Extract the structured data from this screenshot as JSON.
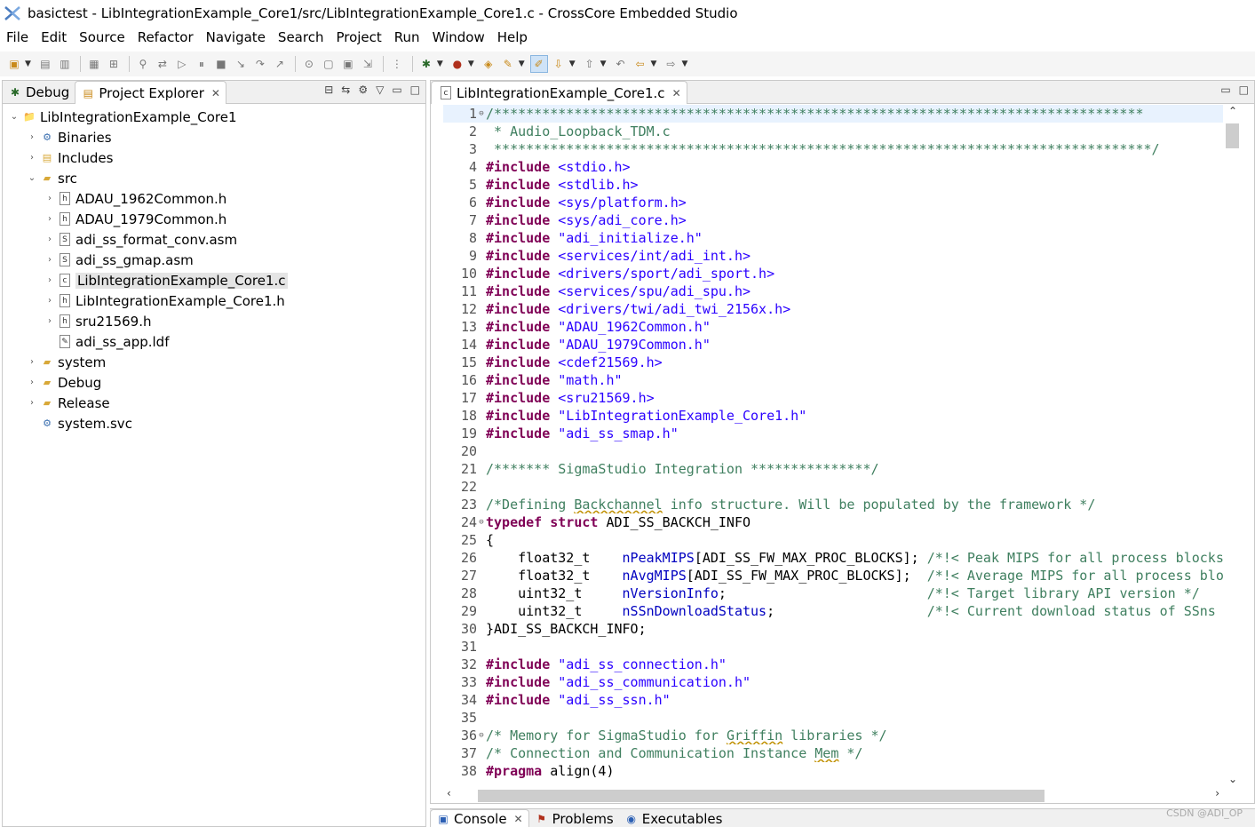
{
  "window": {
    "title": "basictest - LibIntegrationExample_Core1/src/LibIntegrationExample_Core1.c - CrossCore Embedded Studio"
  },
  "menu": [
    "File",
    "Edit",
    "Source",
    "Refactor",
    "Navigate",
    "Search",
    "Project",
    "Run",
    "Window",
    "Help"
  ],
  "left_panel": {
    "tabs": [
      {
        "label": "Debug",
        "icon": "debug-icon"
      },
      {
        "label": "Project Explorer",
        "icon": "project-explorer-icon"
      }
    ],
    "tree": [
      {
        "label": "LibIntegrationExample_Core1",
        "depth": 0,
        "expanded": true,
        "icon": "project-icon"
      },
      {
        "label": "Binaries",
        "depth": 1,
        "expanded": false,
        "icon": "binaries-icon"
      },
      {
        "label": "Includes",
        "depth": 1,
        "expanded": false,
        "icon": "includes-icon"
      },
      {
        "label": "src",
        "depth": 1,
        "expanded": true,
        "icon": "source-folder-icon"
      },
      {
        "label": "ADAU_1962Common.h",
        "depth": 2,
        "expanded": false,
        "icon": "header-file-icon",
        "glyph": "h"
      },
      {
        "label": "ADAU_1979Common.h",
        "depth": 2,
        "expanded": false,
        "icon": "header-file-icon",
        "glyph": "h"
      },
      {
        "label": "adi_ss_format_conv.asm",
        "depth": 2,
        "expanded": false,
        "icon": "asm-file-icon",
        "glyph": "S"
      },
      {
        "label": "adi_ss_gmap.asm",
        "depth": 2,
        "expanded": false,
        "icon": "asm-file-icon",
        "glyph": "S"
      },
      {
        "label": "LibIntegrationExample_Core1.c",
        "depth": 2,
        "expanded": false,
        "icon": "c-file-icon",
        "glyph": "c",
        "selected": true
      },
      {
        "label": "LibIntegrationExample_Core1.h",
        "depth": 2,
        "expanded": false,
        "icon": "header-file-icon",
        "glyph": "h"
      },
      {
        "label": "sru21569.h",
        "depth": 2,
        "expanded": false,
        "icon": "header-file-icon",
        "glyph": "h"
      },
      {
        "label": "adi_ss_app.ldf",
        "depth": 2,
        "leaf": true,
        "icon": "ldf-file-icon",
        "glyph": "✎"
      },
      {
        "label": "system",
        "depth": 1,
        "expanded": false,
        "icon": "system-folder-icon"
      },
      {
        "label": "Debug",
        "depth": 1,
        "expanded": false,
        "icon": "folder-icon"
      },
      {
        "label": "Release",
        "depth": 1,
        "expanded": false,
        "icon": "folder-icon"
      },
      {
        "label": "system.svc",
        "depth": 1,
        "leaf": true,
        "icon": "svc-file-icon"
      }
    ]
  },
  "editor": {
    "tab_label": "LibIntegrationExample_Core1.c",
    "lines": [
      {
        "n": "1",
        "fold": "⊖",
        "hl": true,
        "segs": [
          {
            "t": "/*********************************************************************************",
            "c": "cm"
          }
        ]
      },
      {
        "n": "2",
        "segs": [
          {
            "t": " * Audio_Loopback_TDM.c",
            "c": "cm"
          }
        ]
      },
      {
        "n": "3",
        "segs": [
          {
            "t": " **********************************************************************************/",
            "c": "cm"
          }
        ]
      },
      {
        "n": "4",
        "segs": [
          {
            "t": "#include",
            "c": "kw"
          },
          {
            "t": " "
          },
          {
            "t": "<stdio.h>",
            "c": "str"
          }
        ]
      },
      {
        "n": "5",
        "segs": [
          {
            "t": "#include",
            "c": "kw"
          },
          {
            "t": " "
          },
          {
            "t": "<stdlib.h>",
            "c": "str"
          }
        ]
      },
      {
        "n": "6",
        "segs": [
          {
            "t": "#include",
            "c": "kw"
          },
          {
            "t": " "
          },
          {
            "t": "<sys/platform.h>",
            "c": "str"
          }
        ]
      },
      {
        "n": "7",
        "segs": [
          {
            "t": "#include",
            "c": "kw"
          },
          {
            "t": " "
          },
          {
            "t": "<sys/adi_core.h>",
            "c": "str"
          }
        ]
      },
      {
        "n": "8",
        "segs": [
          {
            "t": "#include",
            "c": "kw"
          },
          {
            "t": " "
          },
          {
            "t": "\"adi_initialize.h\"",
            "c": "str"
          }
        ]
      },
      {
        "n": "9",
        "segs": [
          {
            "t": "#include",
            "c": "kw"
          },
          {
            "t": " "
          },
          {
            "t": "<services/int/adi_int.h>",
            "c": "str"
          }
        ]
      },
      {
        "n": "10",
        "segs": [
          {
            "t": "#include",
            "c": "kw"
          },
          {
            "t": " "
          },
          {
            "t": "<drivers/sport/adi_sport.h>",
            "c": "str"
          }
        ]
      },
      {
        "n": "11",
        "segs": [
          {
            "t": "#include",
            "c": "kw"
          },
          {
            "t": " "
          },
          {
            "t": "<services/spu/adi_spu.h>",
            "c": "str"
          }
        ]
      },
      {
        "n": "12",
        "segs": [
          {
            "t": "#include",
            "c": "kw"
          },
          {
            "t": " "
          },
          {
            "t": "<drivers/twi/adi_twi_2156x.h>",
            "c": "str"
          }
        ]
      },
      {
        "n": "13",
        "segs": [
          {
            "t": "#include",
            "c": "kw"
          },
          {
            "t": " "
          },
          {
            "t": "\"ADAU_1962Common.h\"",
            "c": "str"
          }
        ]
      },
      {
        "n": "14",
        "segs": [
          {
            "t": "#include",
            "c": "kw"
          },
          {
            "t": " "
          },
          {
            "t": "\"ADAU_1979Common.h\"",
            "c": "str"
          }
        ]
      },
      {
        "n": "15",
        "segs": [
          {
            "t": "#include",
            "c": "kw"
          },
          {
            "t": " "
          },
          {
            "t": "<cdef21569.h>",
            "c": "str"
          }
        ]
      },
      {
        "n": "16",
        "segs": [
          {
            "t": "#include",
            "c": "kw"
          },
          {
            "t": " "
          },
          {
            "t": "\"math.h\"",
            "c": "str"
          }
        ]
      },
      {
        "n": "17",
        "segs": [
          {
            "t": "#include",
            "c": "kw"
          },
          {
            "t": " "
          },
          {
            "t": "<sru21569.h>",
            "c": "str"
          }
        ]
      },
      {
        "n": "18",
        "segs": [
          {
            "t": "#include",
            "c": "kw"
          },
          {
            "t": " "
          },
          {
            "t": "\"LibIntegrationExample_Core1.h\"",
            "c": "str"
          }
        ]
      },
      {
        "n": "19",
        "segs": [
          {
            "t": "#include",
            "c": "kw"
          },
          {
            "t": " "
          },
          {
            "t": "\"adi_ss_smap.h\"",
            "c": "str"
          }
        ]
      },
      {
        "n": "20",
        "segs": []
      },
      {
        "n": "21",
        "segs": [
          {
            "t": "/******* SigmaStudio Integration ***************/",
            "c": "cm"
          }
        ]
      },
      {
        "n": "22",
        "segs": []
      },
      {
        "n": "23",
        "segs": [
          {
            "t": "/*Defining ",
            "c": "cm"
          },
          {
            "t": "Backchannel",
            "c": "cm wave"
          },
          {
            "t": " info structure. Will be populated by the framework */",
            "c": "cm"
          }
        ]
      },
      {
        "n": "24",
        "fold": "⊖",
        "segs": [
          {
            "t": "typedef",
            "c": "kw"
          },
          {
            "t": " "
          },
          {
            "t": "struct",
            "c": "kw"
          },
          {
            "t": " ADI_SS_BACKCH_INFO"
          }
        ]
      },
      {
        "n": "25",
        "segs": [
          {
            "t": "{"
          }
        ]
      },
      {
        "n": "26",
        "segs": [
          {
            "t": "    float32_t    "
          },
          {
            "t": "nPeakMIPS",
            "c": "ident"
          },
          {
            "t": "[ADI_SS_FW_MAX_PROC_BLOCKS]; "
          },
          {
            "t": "/*!< Peak MIPS for all process blocks",
            "c": "cm"
          }
        ]
      },
      {
        "n": "27",
        "segs": [
          {
            "t": "    float32_t    "
          },
          {
            "t": "nAvgMIPS",
            "c": "ident"
          },
          {
            "t": "[ADI_SS_FW_MAX_PROC_BLOCKS];  "
          },
          {
            "t": "/*!< Average MIPS for all process blo",
            "c": "cm"
          }
        ]
      },
      {
        "n": "28",
        "segs": [
          {
            "t": "    uint32_t     "
          },
          {
            "t": "nVersionInfo",
            "c": "ident"
          },
          {
            "t": ";                         "
          },
          {
            "t": "/*!< Target library API version */",
            "c": "cm"
          }
        ]
      },
      {
        "n": "29",
        "segs": [
          {
            "t": "    uint32_t     "
          },
          {
            "t": "nSSnDownloadStatus",
            "c": "ident"
          },
          {
            "t": ";                   "
          },
          {
            "t": "/*!< Current download status of SSns w",
            "c": "cm"
          }
        ]
      },
      {
        "n": "30",
        "segs": [
          {
            "t": "}ADI_SS_BACKCH_INFO;"
          }
        ]
      },
      {
        "n": "31",
        "segs": []
      },
      {
        "n": "32",
        "segs": [
          {
            "t": "#include",
            "c": "kw"
          },
          {
            "t": " "
          },
          {
            "t": "\"adi_ss_connection.h\"",
            "c": "str"
          }
        ]
      },
      {
        "n": "33",
        "segs": [
          {
            "t": "#include",
            "c": "kw"
          },
          {
            "t": " "
          },
          {
            "t": "\"adi_ss_communication.h\"",
            "c": "str"
          }
        ]
      },
      {
        "n": "34",
        "segs": [
          {
            "t": "#include",
            "c": "kw"
          },
          {
            "t": " "
          },
          {
            "t": "\"adi_ss_ssn.h\"",
            "c": "str"
          }
        ]
      },
      {
        "n": "35",
        "segs": []
      },
      {
        "n": "36",
        "fold": "⊖",
        "segs": [
          {
            "t": "/* Memory for SigmaStudio for ",
            "c": "cm"
          },
          {
            "t": "Griffin",
            "c": "cm wave"
          },
          {
            "t": " libraries */",
            "c": "cm"
          }
        ]
      },
      {
        "n": "37",
        "segs": [
          {
            "t": "/* Connection and Communication Instance ",
            "c": "cm"
          },
          {
            "t": "Mem",
            "c": "cm wave"
          },
          {
            "t": " */",
            "c": "cm"
          }
        ]
      },
      {
        "n": "38",
        "segs": [
          {
            "t": "#pragma",
            "c": "kw"
          },
          {
            "t": " align(4)"
          }
        ]
      }
    ]
  },
  "bottom_tabs": [
    {
      "label": "Console",
      "icon": "console-icon"
    },
    {
      "label": "Problems",
      "icon": "problems-icon"
    },
    {
      "label": "Executables",
      "icon": "executables-icon"
    }
  ],
  "watermark": "CSDN @ADI_OP",
  "colors": {
    "keyword": "#7f0055",
    "string": "#2a00ff",
    "comment": "#3f7f5f",
    "identifier": "#0000c0",
    "current_line": "#e8f2fe"
  }
}
